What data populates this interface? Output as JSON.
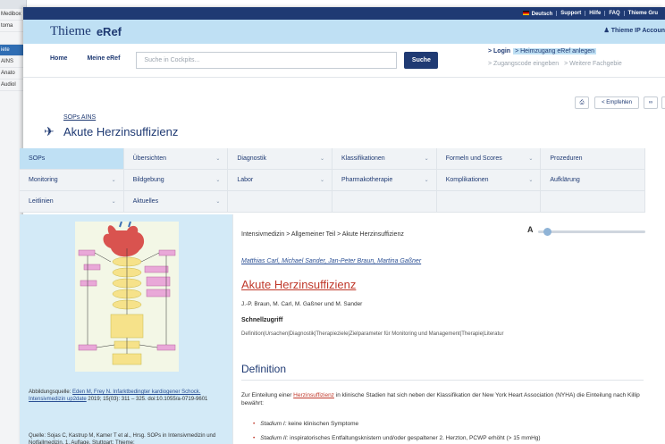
{
  "background_window": {
    "items": [
      "Medibox",
      "toma",
      "",
      "iete",
      "AINS",
      "Anato",
      "Audiol"
    ],
    "selected_index": 3
  },
  "topbar": {
    "links": [
      "Deutsch",
      "Support",
      "Hilfe",
      "FAQ",
      "Thieme Gru"
    ]
  },
  "brand": {
    "logo": "Thieme",
    "product": "eRef",
    "account": "Thieme IP Accoun"
  },
  "nav": {
    "home": "Home",
    "my": "Meine eRef",
    "search_placeholder": "Suche in Cockpits...",
    "search_button": "Suche",
    "login": "> Login",
    "home_access": "> Heimzugang eRef anlegen",
    "access_code": "> Zugangscode eingeben",
    "more": "> Weitere Fachgebie"
  },
  "tools": {
    "share": "Empfehlen"
  },
  "page": {
    "breadcrumb": "SOPs AINS",
    "title": "Akute Herzinsuffizienz"
  },
  "categories": [
    [
      {
        "label": "SOPs",
        "chev": false,
        "sel": true
      },
      {
        "label": "Übersichten",
        "chev": true
      },
      {
        "label": "Diagnostik",
        "chev": true
      },
      {
        "label": "Klassifikationen",
        "chev": true
      },
      {
        "label": "Formeln und Scores",
        "chev": true
      },
      {
        "label": "Prozeduren",
        "chev": false
      }
    ],
    [
      {
        "label": "Monitoring",
        "chev": true
      },
      {
        "label": "Bildgebung",
        "chev": true
      },
      {
        "label": "Labor",
        "chev": true
      },
      {
        "label": "Pharmakotherapie",
        "chev": true
      },
      {
        "label": "Komplikationen",
        "chev": true
      },
      {
        "label": "Aufklärung",
        "chev": false
      }
    ],
    [
      {
        "label": "Leitlinien",
        "chev": true
      },
      {
        "label": "Aktuelles",
        "chev": true
      },
      {
        "label": "",
        "chev": false
      },
      {
        "label": "",
        "chev": false
      },
      {
        "label": "",
        "chev": false
      },
      {
        "label": "",
        "chev": false
      }
    ]
  ],
  "figure": {
    "caption_prefix": "Abbildungsquelle: ",
    "caption_link": "Eden M, Frey N. Infarktbedingter kardiogener Schock. Intensivmedizin up2date",
    "caption_rest": " 2019; 15(03): 311 – 325. doi:10.1055/a-0719-9601",
    "source_prefix": "Quelle: ",
    "source_link": "Sojas C, Kastrup M, Kamer T",
    "source_rest": " et al., Hrsg. SOPs in Intensivmedizin und Notfallmedizin. 1. Auflage. Stuttgart: Thieme;"
  },
  "content": {
    "breadcrumb": "Intensivmedizin > Allgemeiner Teil > Akute Herzinsuffizienz",
    "font_size_label": "A",
    "font_size_level": 0.05,
    "authors": "Matthias Carl, Michael Sander, Jan-Peter Braun, Martina Gaßner",
    "title": "Akute Herzinsuffizienz",
    "byline": "J.-P. Braun, M. Carl, M. Gaßner und M. Sander",
    "quick_heading": "Schnellzugriff",
    "quick_links": "Definition|Ursachen|Diagnostik|Therapieziele|Zielparameter für Monitoring und Management|Therapie|Literatur",
    "def_heading": "Definition",
    "def_pre": "Zur Einteilung einer ",
    "def_link": "Herzinsuffizienz",
    "def_post": " in klinische Stadien hat sich neben der Klassifikation der New York Heart Association (NYHA) die Einteilung nach Killip bewährt:",
    "bullets": [
      {
        "term": "Stadium I:",
        "text": " keine klinischen Symptome"
      },
      {
        "term": "Stadium II:",
        "text": " inspiratorisches Entfaltungsknistern und/oder gespaltener 2. Herzton, PCWP erhöht (> 15 mmHg)"
      }
    ]
  }
}
